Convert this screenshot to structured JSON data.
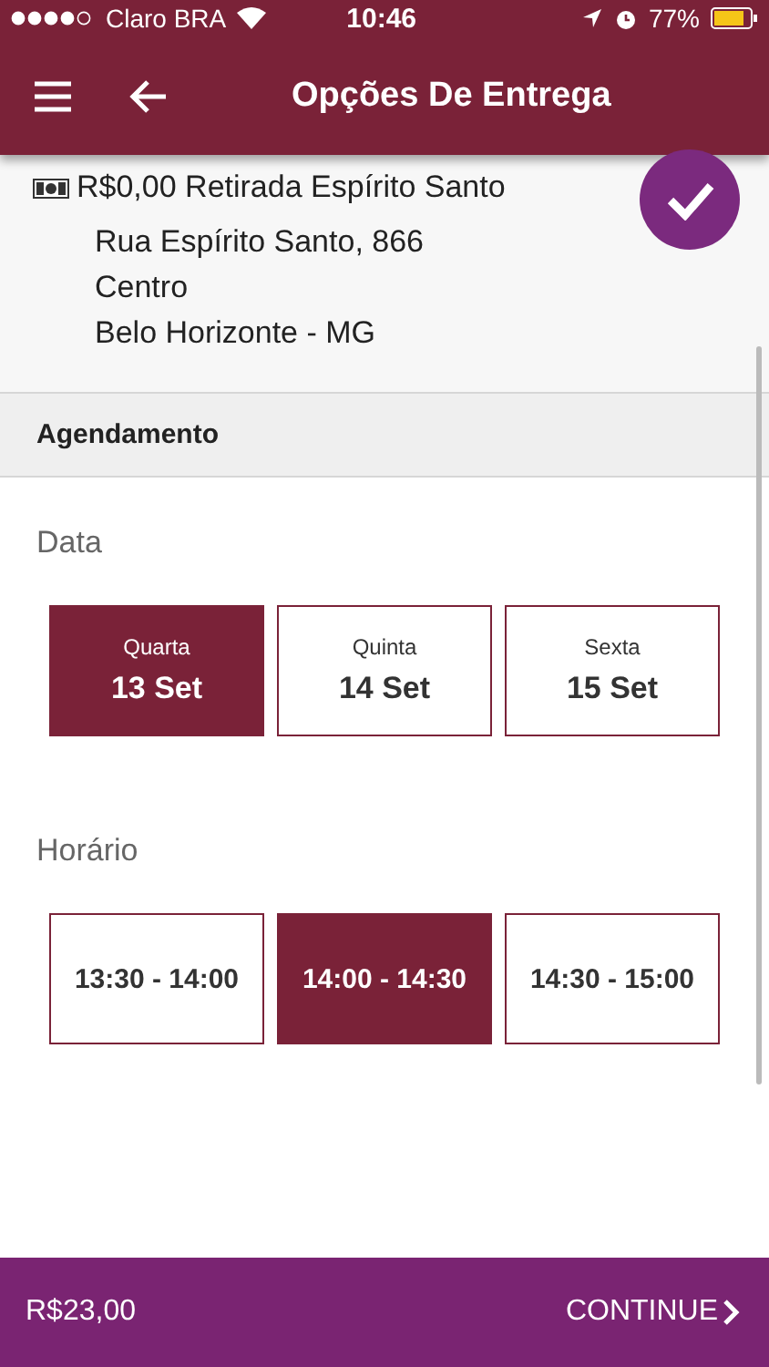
{
  "status_bar": {
    "carrier": "Claro BRA",
    "time": "10:46",
    "battery": "77%"
  },
  "app_bar": {
    "title": "Opções De Entrega"
  },
  "delivery_option": {
    "title": "R$0,00 Retirada Espírito Santo",
    "address_lines": [
      "Rua Espírito Santo, 866",
      "Centro",
      "Belo Horizonte - MG"
    ],
    "selected": true
  },
  "section": {
    "title": "Agendamento"
  },
  "date_group": {
    "label": "Data",
    "options": [
      {
        "weekday": "Quarta",
        "date": "13 Set",
        "selected": true
      },
      {
        "weekday": "Quinta",
        "date": "14 Set",
        "selected": false
      },
      {
        "weekday": "Sexta",
        "date": "15 Set",
        "selected": false
      }
    ]
  },
  "time_group": {
    "label": "Horário",
    "options": [
      {
        "label": "13:30 - 14:00",
        "selected": false
      },
      {
        "label": "14:00 - 14:30",
        "selected": true
      },
      {
        "label": "14:30 - 15:00",
        "selected": false
      }
    ]
  },
  "footer": {
    "total": "R$23,00",
    "button": "CONTINUE"
  }
}
